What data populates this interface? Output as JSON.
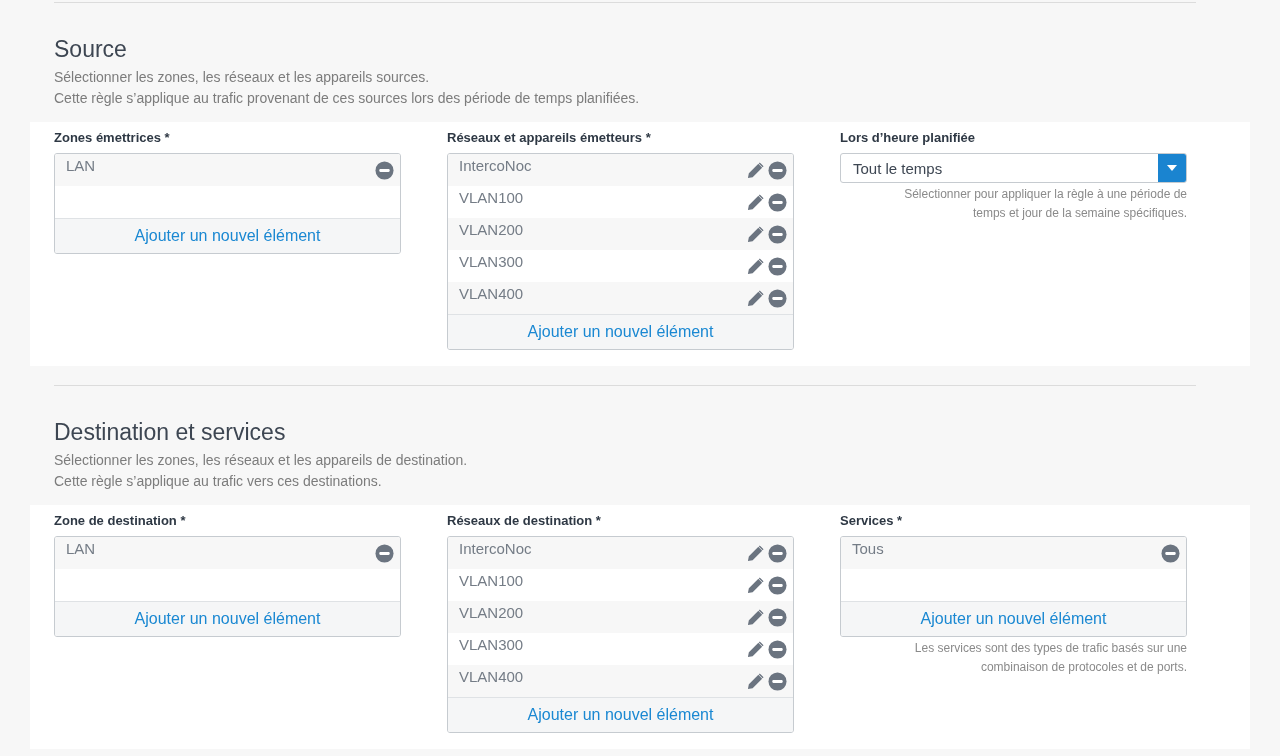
{
  "sections": [
    {
      "title": "Source",
      "description": [
        "Sélectionner les zones, les réseaux et les appareils sources.",
        "Cette règle s’applique au trafic provenant de ces sources lors des période de temps planifiées."
      ],
      "fields": [
        {
          "kind": "list",
          "label": "Zones émettrices *",
          "items": [
            {
              "text": "LAN",
              "editable": false
            }
          ],
          "add_label": "Ajouter un nouvel élément"
        },
        {
          "kind": "list",
          "label": "Réseaux et appareils émetteurs *",
          "items": [
            {
              "text": "IntercoNoc",
              "editable": true
            },
            {
              "text": "VLAN100",
              "editable": true
            },
            {
              "text": "VLAN200",
              "editable": true
            },
            {
              "text": "VLAN300",
              "editable": true
            },
            {
              "text": "VLAN400",
              "editable": true
            }
          ],
          "add_label": "Ajouter un nouvel élément"
        },
        {
          "kind": "select",
          "label": "Lors d’heure planifiée",
          "value": "Tout le temps",
          "help": [
            "Sélectionner pour appliquer la règle à une période de",
            "temps et jour de la semaine spécifiques."
          ]
        }
      ]
    },
    {
      "title": "Destination et services",
      "description": [
        "Sélectionner les zones, les réseaux et les appareils de destination.",
        "Cette règle s’applique au trafic vers ces destinations."
      ],
      "fields": [
        {
          "kind": "list",
          "label": "Zone de destination *",
          "items": [
            {
              "text": "LAN",
              "editable": false
            }
          ],
          "add_label": "Ajouter un nouvel élément"
        },
        {
          "kind": "list",
          "label": "Réseaux de destination *",
          "items": [
            {
              "text": "IntercoNoc",
              "editable": true
            },
            {
              "text": "VLAN100",
              "editable": true
            },
            {
              "text": "VLAN200",
              "editable": true
            },
            {
              "text": "VLAN300",
              "editable": true
            },
            {
              "text": "VLAN400",
              "editable": true
            }
          ],
          "add_label": "Ajouter un nouvel élément"
        },
        {
          "kind": "list",
          "label": "Services *",
          "items": [
            {
              "text": "Tous",
              "editable": false
            }
          ],
          "add_label": "Ajouter un nouvel élément",
          "help": [
            "Les services sont des types de trafic basés sur une",
            "combinaison de protocoles et de ports."
          ]
        }
      ]
    }
  ]
}
